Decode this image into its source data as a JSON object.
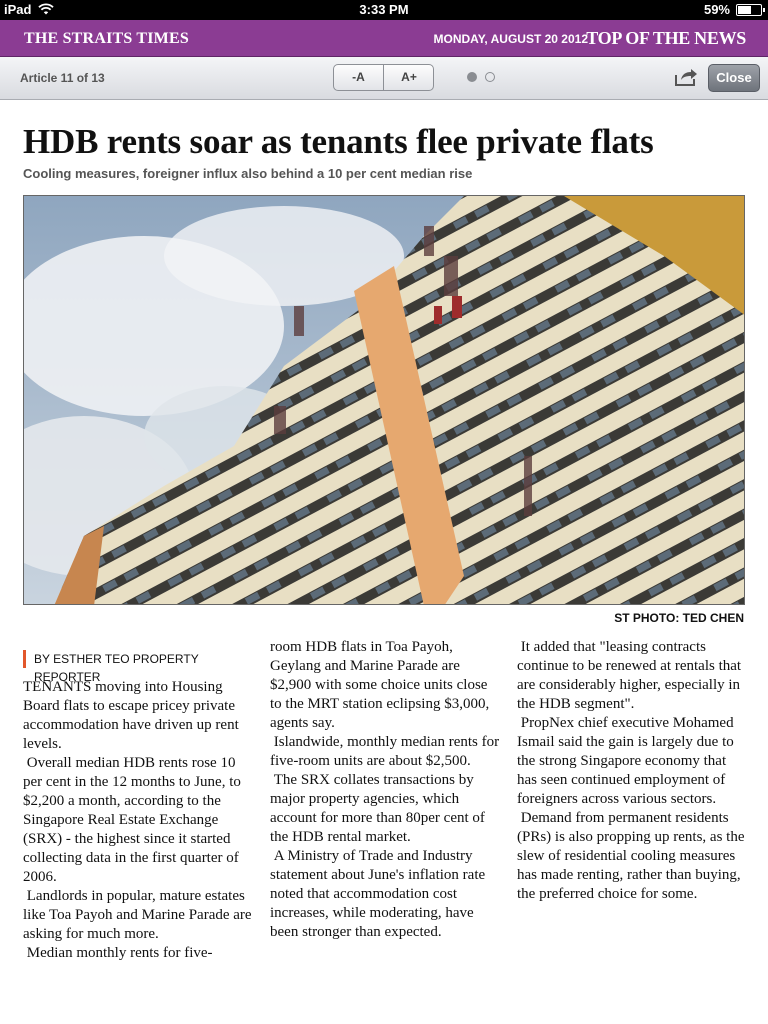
{
  "status_bar": {
    "device": "iPad",
    "time": "3:33 PM",
    "battery": "59%",
    "battery_level": 0.59
  },
  "masthead": {
    "brand": "THE STRAITS TIMES",
    "date": "MONDAY, AUGUST 20 2012",
    "section": "TOP OF THE NEWS",
    "color": "#8b3c93"
  },
  "toolbar": {
    "counter": "Article 11 of 13",
    "font_decrease": "-A",
    "font_increase": "A+",
    "page_indicator": {
      "current": 1,
      "total": 2
    },
    "share_icon": "share-arrow-icon",
    "close": "Close"
  },
  "article": {
    "headline": "HDB rents soar as tenants flee private flats",
    "subhead": "Cooling measures, foreigner influx also behind a 10 per cent median rise",
    "photo_credit": "ST PHOTO: TED CHEN",
    "byline": "BY ESTHER TEO PROPERTY REPORTER",
    "byline_accent": "#e2572b",
    "columns": [
      [
        "TENANTS moving into Housing Board flats to escape pricey private accommodation have driven up rent levels.",
        " Overall median HDB rents rose 10 per cent in the 12 months to June, to $2,200 a month, according to the Singapore Real Estate Exchange (SRX) - the highest since it started collecting data in the first quarter of 2006.",
        " Landlords in popular, mature estates like Toa Payoh and Marine Parade are asking for much more.",
        " Median monthly rents for five-"
      ],
      [
        "room HDB flats in Toa Payoh, Geylang and Marine Parade are $2,900 with some choice units close to the MRT station eclipsing $3,000, agents say.",
        " Islandwide, monthly median rents for five-room units are about $2,500.",
        " The SRX collates transactions by major property agencies, which account for more than 80per cent of the HDB rental market.",
        " A Ministry of Trade and Industry statement about June's inflation rate noted that accommodation cost increases, while moderating, have been stronger than expected."
      ],
      [
        " It added that \"leasing contracts continue to be renewed at rentals that are considerably higher, especially in the HDB segment\".",
        " PropNex chief executive Mohamed Ismail said the gain is largely due to the strong Singapore economy that has seen continued employment of foreigners across various sectors.",
        " Demand from permanent residents (PRs) is also propping up rents, as the slew of residential cooling measures has made renting, rather than buying, the preferred choice for some."
      ]
    ]
  }
}
